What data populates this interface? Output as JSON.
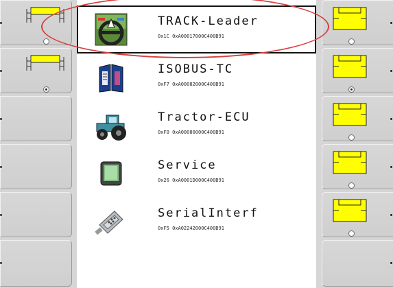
{
  "items": [
    {
      "name": "TRACK-Leader",
      "id": "0x1C 0xA00017000C400B91",
      "icon": "steering-wheel-icon",
      "selected": true
    },
    {
      "name": "ISOBUS-TC",
      "id": "0xF7 0xA00082000C400B91",
      "icon": "task-controller-book-icon",
      "selected": false
    },
    {
      "name": "Tractor-ECU",
      "id": "0xF0 0xA00086000C400B91",
      "icon": "tractor-icon",
      "selected": false
    },
    {
      "name": "Service",
      "id": "0x26 0xA0001D000C400B91",
      "icon": "terminal-icon",
      "selected": false
    },
    {
      "name": "SerialInterf",
      "id": "0xF5 0xA02242000C400B91",
      "icon": "serial-connector-icon",
      "selected": false
    }
  ],
  "softkeys_left": [
    {
      "pictogram": "boom-section-icon",
      "radio": "off"
    },
    {
      "pictogram": "boom-section-icon",
      "radio": "on"
    },
    {
      "pictogram": "",
      "radio": ""
    },
    {
      "pictogram": "",
      "radio": ""
    },
    {
      "pictogram": "",
      "radio": ""
    },
    {
      "pictogram": "",
      "radio": ""
    }
  ],
  "softkeys_right": [
    {
      "pictogram": "boom-section-filled-icon",
      "radio": "off"
    },
    {
      "pictogram": "boom-section-filled-icon",
      "radio": "on"
    },
    {
      "pictogram": "boom-section-filled-icon",
      "radio": "off"
    },
    {
      "pictogram": "boom-section-filled-icon",
      "radio": "off"
    },
    {
      "pictogram": "boom-section-filled-icon",
      "radio": "off"
    },
    {
      "pictogram": "",
      "radio": ""
    }
  ],
  "colors": {
    "highlight": "#d94040",
    "section_fill": "#ffff00",
    "panel": "#d6d6d6",
    "list_bg": "#ffffff"
  }
}
